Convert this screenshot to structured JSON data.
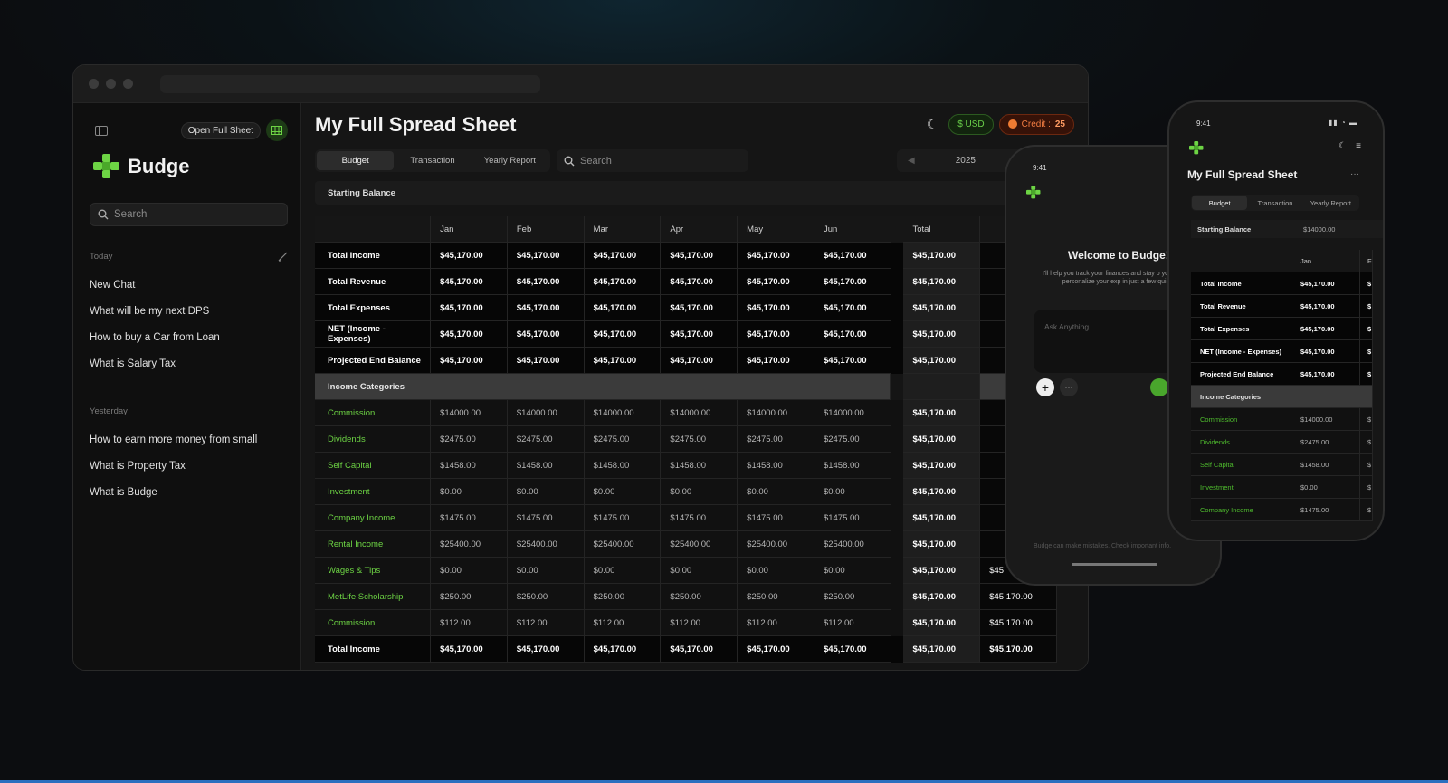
{
  "sidebar": {
    "open_full_sheet": "Open Full Sheet",
    "app_name": "Budge",
    "search_placeholder": "Search",
    "today_label": "Today",
    "today_items": [
      "New Chat",
      "What will be my next DPS",
      "How to buy a Car from Loan",
      "What is Salary Tax"
    ],
    "yesterday_label": "Yesterday",
    "yesterday_items": [
      "How to earn more money from small",
      "What is Property Tax",
      "What is Budge"
    ]
  },
  "main": {
    "title": "My Full Spread Sheet",
    "currency": "$ USD",
    "credit_label": "Credit :",
    "credit_value": "25",
    "tabs": [
      "Budget",
      "Transaction",
      "Yearly Report"
    ],
    "search_placeholder": "Search",
    "year": "2025",
    "starting_balance_label": "Starting Balance",
    "columns": [
      "Jan",
      "Feb",
      "Mar",
      "Apr",
      "May",
      "Jun"
    ],
    "total_label": "Total",
    "summary_rows": [
      {
        "label": "Total Income",
        "values": [
          "$45,170.00",
          "$45,170.00",
          "$45,170.00",
          "$45,170.00",
          "$45,170.00",
          "$45,170.00"
        ],
        "total": "$45,170.00"
      },
      {
        "label": "Total Revenue",
        "values": [
          "$45,170.00",
          "$45,170.00",
          "$45,170.00",
          "$45,170.00",
          "$45,170.00",
          "$45,170.00"
        ],
        "total": "$45,170.00"
      },
      {
        "label": "Total Expenses",
        "values": [
          "$45,170.00",
          "$45,170.00",
          "$45,170.00",
          "$45,170.00",
          "$45,170.00",
          "$45,170.00"
        ],
        "total": "$45,170.00"
      },
      {
        "label": "NET (Income - Expenses)",
        "values": [
          "$45,170.00",
          "$45,170.00",
          "$45,170.00",
          "$45,170.00",
          "$45,170.00",
          "$45,170.00"
        ],
        "total": "$45,170.00"
      },
      {
        "label": "Projected End Balance",
        "values": [
          "$45,170.00",
          "$45,170.00",
          "$45,170.00",
          "$45,170.00",
          "$45,170.00",
          "$45,170.00"
        ],
        "total": "$45,170.00"
      }
    ],
    "section_label": "Income Categories",
    "category_rows": [
      {
        "label": "Commission",
        "values": [
          "$14000.00",
          "$14000.00",
          "$14000.00",
          "$14000.00",
          "$14000.00",
          "$14000.00"
        ],
        "total": "$45,170.00",
        "extra": ""
      },
      {
        "label": "Dividends",
        "values": [
          "$2475.00",
          "$2475.00",
          "$2475.00",
          "$2475.00",
          "$2475.00",
          "$2475.00"
        ],
        "total": "$45,170.00",
        "extra": ""
      },
      {
        "label": "Self Capital",
        "values": [
          "$1458.00",
          "$1458.00",
          "$1458.00",
          "$1458.00",
          "$1458.00",
          "$1458.00"
        ],
        "total": "$45,170.00",
        "extra": ""
      },
      {
        "label": "Investment",
        "values": [
          "$0.00",
          "$0.00",
          "$0.00",
          "$0.00",
          "$0.00",
          "$0.00"
        ],
        "total": "$45,170.00",
        "extra": ""
      },
      {
        "label": "Company Income",
        "values": [
          "$1475.00",
          "$1475.00",
          "$1475.00",
          "$1475.00",
          "$1475.00",
          "$1475.00"
        ],
        "total": "$45,170.00",
        "extra": ""
      },
      {
        "label": "Rental Income",
        "values": [
          "$25400.00",
          "$25400.00",
          "$25400.00",
          "$25400.00",
          "$25400.00",
          "$25400.00"
        ],
        "total": "$45,170.00",
        "extra": ""
      },
      {
        "label": "Wages & Tips",
        "values": [
          "$0.00",
          "$0.00",
          "$0.00",
          "$0.00",
          "$0.00",
          "$0.00"
        ],
        "total": "$45,170.00",
        "extra": "$45,"
      },
      {
        "label": "MetLife Scholarship",
        "values": [
          "$250.00",
          "$250.00",
          "$250.00",
          "$250.00",
          "$250.00",
          "$250.00"
        ],
        "total": "$45,170.00",
        "extra": "$45,170.00"
      },
      {
        "label": "Commission",
        "values": [
          "$112.00",
          "$112.00",
          "$112.00",
          "$112.00",
          "$112.00",
          "$112.00"
        ],
        "total": "$45,170.00",
        "extra": "$45,170.00"
      }
    ],
    "final_row": {
      "label": "Total Income",
      "values": [
        "$45,170.00",
        "$45,170.00",
        "$45,170.00",
        "$45,170.00",
        "$45,170.00",
        "$45,170.00"
      ],
      "total": "$45,170.00",
      "extra": "$45,170.00"
    }
  },
  "phone_chat": {
    "time": "9:41",
    "welcome": "Welcome to Budge! 🚀",
    "subtitle": "I'll help you track your finances and stay o your money. Let's personalize your exp in just a few quick steps!",
    "ask_placeholder": "Ask Anything",
    "disclaimer": "Budge can make mistakes. Check important info."
  },
  "phone_sheet": {
    "time": "9:41",
    "title": "My Full Spread Sheet",
    "tabs": [
      "Budget",
      "Transaction",
      "Yearly Report"
    ],
    "starting_balance_label": "Starting Balance",
    "starting_balance_value": "$14000.00",
    "col_jan": "Jan",
    "col_next": "F",
    "summary_rows": [
      {
        "label": "Total Income",
        "value": "$45,170.00"
      },
      {
        "label": "Total Revenue",
        "value": "$45,170.00"
      },
      {
        "label": "Total Expenses",
        "value": "$45,170.00"
      },
      {
        "label": "NET (Income - Expenses)",
        "value": "$45,170.00"
      },
      {
        "label": "Projected End Balance",
        "value": "$45,170.00"
      }
    ],
    "section_label": "Income Categories",
    "category_rows": [
      {
        "label": "Commission",
        "value": "$14000.00"
      },
      {
        "label": "Dividends",
        "value": "$2475.00"
      },
      {
        "label": "Self Capital",
        "value": "$1458.00"
      },
      {
        "label": "Investment",
        "value": "$0.00"
      },
      {
        "label": "Company Income",
        "value": "$1475.00"
      }
    ],
    "trunc": "$"
  },
  "colors": {
    "accent_green": "#6dd444",
    "credit_orange": "#f07b32",
    "background": "#0c0d10"
  }
}
